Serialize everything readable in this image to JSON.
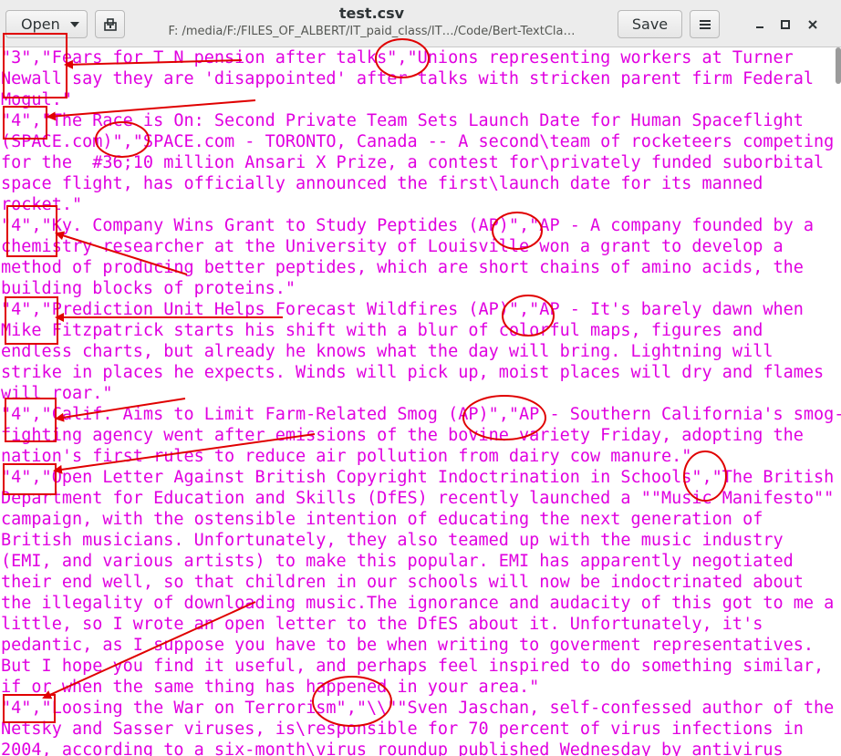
{
  "header": {
    "open_label": "Open",
    "title": "test.csv",
    "subtitle": "F: /media/F:/FILES_OF_ALBERT/IT_paid_class/IT…/Code/Bert-TextCla…",
    "save_label": "Save",
    "icons": {
      "open_caret": "chevron-down-icon",
      "pin": "pin-document-icon",
      "menu": "hamburger-menu-icon",
      "minimize": "minimize-icon",
      "maximize": "maximize-icon",
      "close": "close-icon"
    }
  },
  "editor": {
    "text_color": "#e000e0",
    "lines": [
      "\"3\",\"Fears for T N pension after talks\",\"Unions representing workers at Turner",
      "Newall say they are 'disappointed' after talks with stricken parent firm Federal",
      "Mogul.\"",
      "\"4\",\"The Race is On: Second Private Team Sets Launch Date for Human Spaceflight",
      "(SPACE.com)\",\"SPACE.com - TORONTO, Canada -- A second\\team of rocketeers competing",
      "for the  #36;10 million Ansari X Prize, a contest for\\privately funded suborbital",
      "space flight, has officially announced the first\\launch date for its manned",
      "rocket.\"",
      "\"4\",\"Ky. Company Wins Grant to Study Peptides (AP)\",\"AP - A company founded by a",
      "chemistry researcher at the University of Louisville won a grant to develop a",
      "method of producing better peptides, which are short chains of amino acids, the",
      "building blocks of proteins.\"",
      "\"4\",\"Prediction Unit Helps Forecast Wildfires (AP)\",\"AP - It's barely dawn when",
      "Mike Fitzpatrick starts his shift with a blur of colorful maps, figures and",
      "endless charts, but already he knows what the day will bring. Lightning will",
      "strike in places he expects. Winds will pick up, moist places will dry and flames",
      "will roar.\"",
      "\"4\",\"Calif. Aims to Limit Farm-Related Smog (AP)\",\"AP - Southern California's smog-",
      "fighting agency went after emissions of the bovine variety Friday, adopting the",
      "nation's first rules to reduce air pollution from dairy cow manure.\"",
      "\"4\",\"Open Letter Against British Copyright Indoctrination in Schools\",\"The British",
      "Department for Education and Skills (DfES) recently launched a \"\"Music Manifesto\"\"",
      "campaign, with the ostensible intention of educating the next generation of",
      "British musicians. Unfortunately, they also teamed up with the music industry",
      "(EMI, and various artists) to make this popular. EMI has apparently negotiated",
      "their end well, so that children in our schools will now be indoctrinated about",
      "the illegality of downloading music.The ignorance and audacity of this got to me a",
      "little, so I wrote an open letter to the DfES about it. Unfortunately, it's",
      "pedantic, as I suppose you have to be when writing to goverment representatives.",
      "But I hope you find it useful, and perhaps feel inspired to do something similar,",
      "if or when the same thing has happened in your area.\"",
      "\"4\",\"Loosing the War on Terrorism\",\"\\\\\"\"Sven Jaschan, self-confessed author of the",
      "Netsky and Sasser viruses, is\\responsible for 70 percent of virus infections in",
      "2004, according to a six-month\\virus roundup published Wednesday by antivirus"
    ]
  },
  "annotations": {
    "color": "#e00000"
  }
}
